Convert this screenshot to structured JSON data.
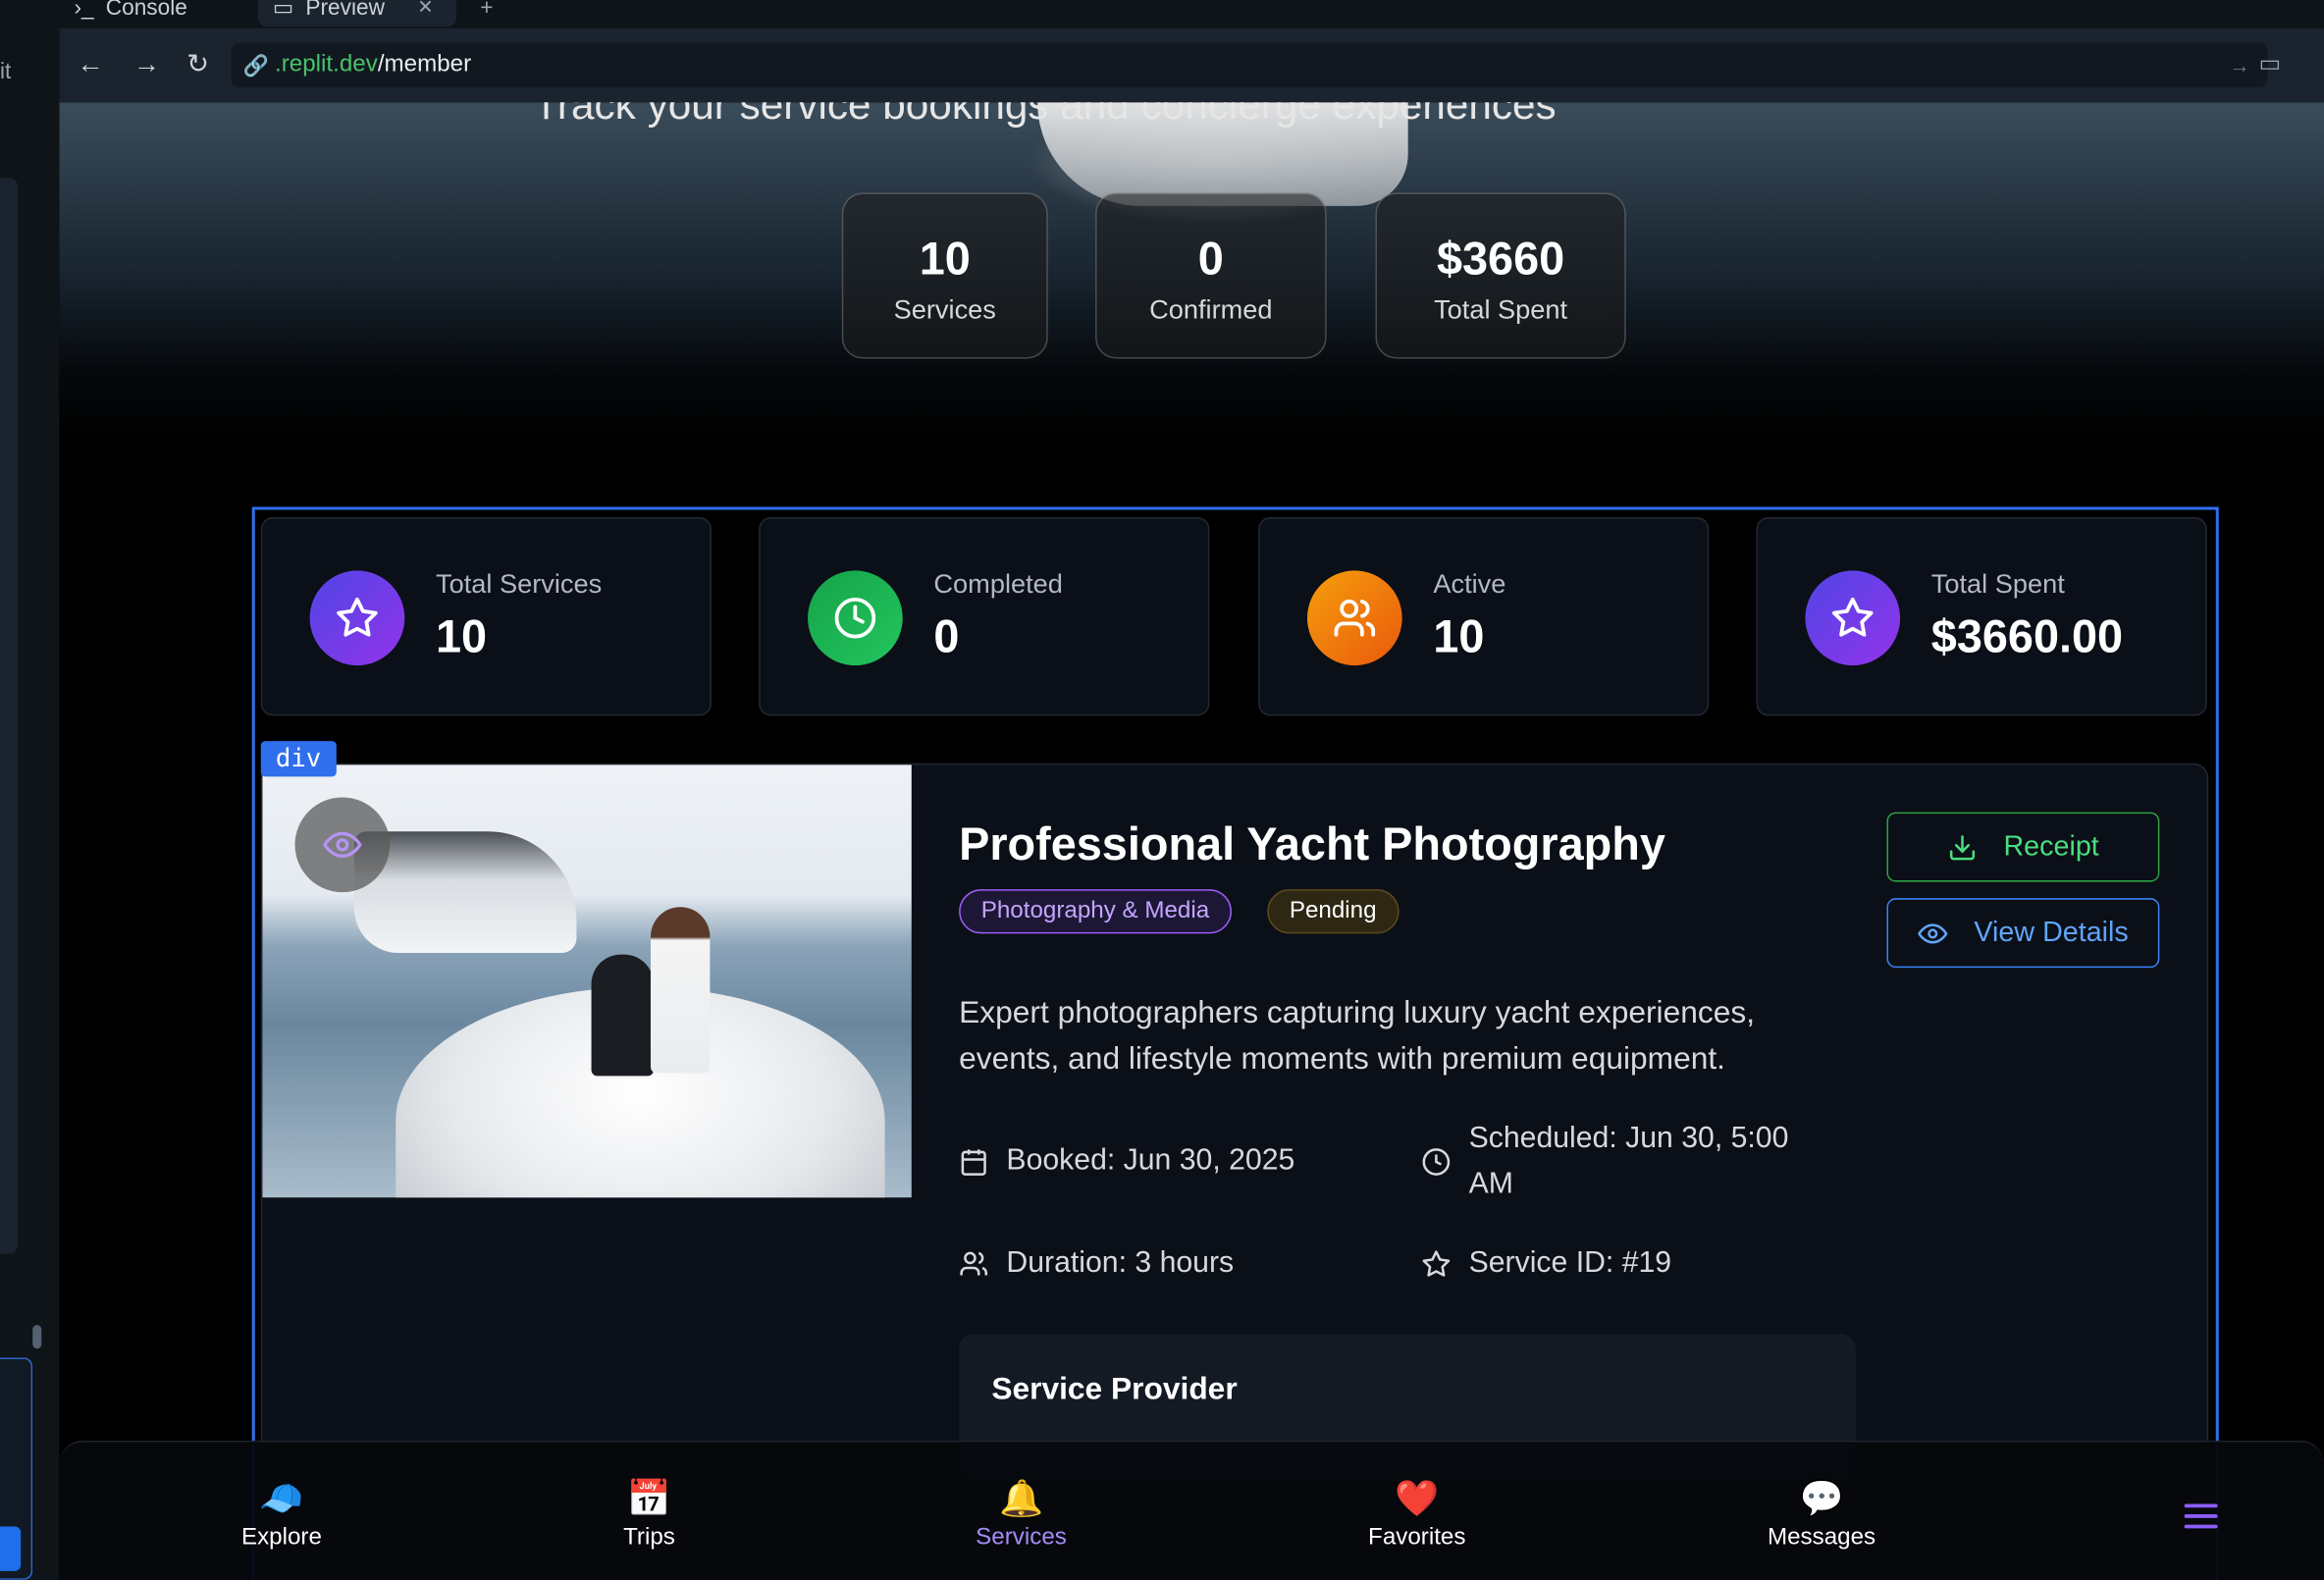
{
  "browser": {
    "tabs": [
      {
        "label": "Console"
      },
      {
        "label": "Preview"
      }
    ],
    "url_domain": ".replit.dev",
    "url_path": "/member",
    "left_strip_text": "it"
  },
  "hero": {
    "subtitle": "Track your service bookings and concierge experiences",
    "stats": [
      {
        "value": "10",
        "label": "Services"
      },
      {
        "value": "0",
        "label": "Confirmed"
      },
      {
        "value": "$3660",
        "label": "Total Spent"
      }
    ]
  },
  "inspector": {
    "tag": "div"
  },
  "summary_cards": [
    {
      "label": "Total Services",
      "value": "10",
      "icon": "star-icon",
      "color": "#7c3aed"
    },
    {
      "label": "Completed",
      "value": "0",
      "icon": "clock-icon",
      "color": "#16a34a"
    },
    {
      "label": "Active",
      "value": "10",
      "icon": "users-icon",
      "color": "#ea580c"
    },
    {
      "label": "Total Spent",
      "value": "$3660.00",
      "icon": "star-icon",
      "color": "#7c3aed"
    }
  ],
  "booking": {
    "title": "Professional Yacht Photography",
    "category": "Photography & Media",
    "status": "Pending",
    "description": "Expert photographers capturing luxury yacht experiences, events, and lifestyle moments with premium equipment.",
    "booked": "Booked: Jun 30, 2025",
    "scheduled": "Scheduled: Jun 30, 5:00 AM",
    "duration": "Duration: 3 hours",
    "service_id": "Service ID: #19",
    "receipt_label": "Receipt",
    "details_label": "View Details",
    "provider_title": "Service Provider"
  },
  "bottom_nav": [
    {
      "label": "Explore",
      "icon": "captain-hat-icon",
      "glyph": "🧢",
      "active": false
    },
    {
      "label": "Trips",
      "icon": "calendar-icon",
      "glyph": "📅",
      "active": false
    },
    {
      "label": "Services",
      "icon": "bell-icon",
      "glyph": "🔔",
      "active": true
    },
    {
      "label": "Favorites",
      "icon": "heart-icon",
      "glyph": "❤️",
      "active": false
    },
    {
      "label": "Messages",
      "icon": "chat-icon",
      "glyph": "💬",
      "active": false
    }
  ],
  "colors": {
    "accent": "#7c3aed",
    "inspector_blue": "#2f6fed",
    "receipt_green": "#4ade80",
    "details_blue": "#60a5fa"
  }
}
